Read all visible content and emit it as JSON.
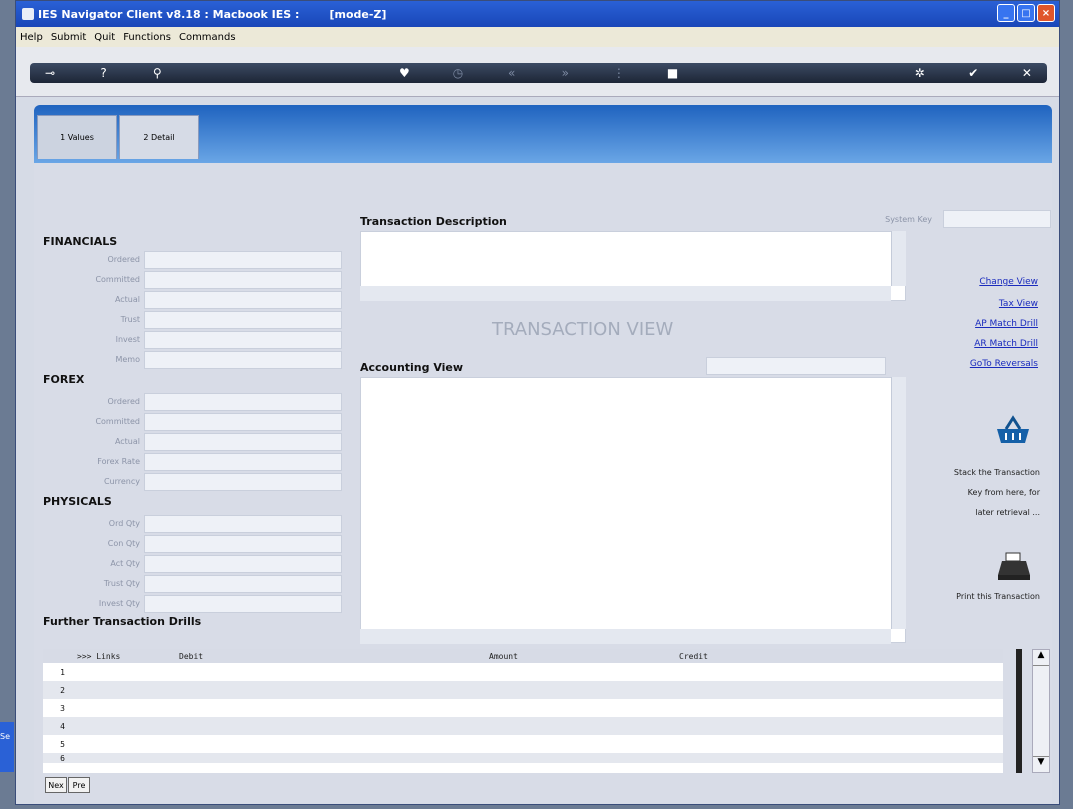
{
  "window": {
    "title": "IES Navigator Client v8.18 : Macbook IES :",
    "mode": "[mode-Z]"
  },
  "menu": [
    "Help",
    "Submit",
    "Quit",
    "Functions",
    "Commands"
  ],
  "toolbar": {
    "icons": [
      "key-icon",
      "help-icon",
      "search-icon",
      "heart-icon",
      "clock-icon",
      "rewind-icon",
      "fast-forward-icon",
      "list-icon",
      "stop-icon",
      "gear-icon",
      "check-icon",
      "cancel-icon"
    ]
  },
  "tabs": [
    {
      "label": "1 Values"
    },
    {
      "label": "2 Detail"
    }
  ],
  "sections": {
    "financials": {
      "title": "FINANCIALS",
      "fields": [
        "Ordered",
        "Committed",
        "Actual",
        "Trust",
        "Invest",
        "Memo"
      ]
    },
    "forex": {
      "title": "FOREX",
      "fields": [
        "Ordered",
        "Committed",
        "Actual",
        "Forex Rate",
        "Currency"
      ]
    },
    "physicals": {
      "title": "PHYSICALS",
      "fields": [
        "Ord Qty",
        "Con Qty",
        "Act Qty",
        "Trust Qty",
        "Invest Qty"
      ]
    },
    "further": {
      "title": "Further Transaction Drills"
    }
  },
  "transaction": {
    "description_label": "Transaction Description",
    "system_key_label": "System Key",
    "view_title": "TRANSACTION VIEW",
    "accounting_label": "Accounting View"
  },
  "links": [
    "Change View",
    "Tax View",
    "AP Match Drill",
    "AR Match Drill",
    "GoTo Reversals"
  ],
  "stack_note": [
    "Stack the Transaction",
    "Key from here, for",
    "later retrieval ..."
  ],
  "print_note": "Print this Transaction",
  "grid": {
    "columns": [
      ">>> Links",
      "Debit",
      "Amount",
      "Credit"
    ],
    "rows": [
      "1",
      "2",
      "3",
      "4",
      "5",
      "6"
    ]
  },
  "bottom_buttons": [
    "Nex",
    "Pre"
  ]
}
